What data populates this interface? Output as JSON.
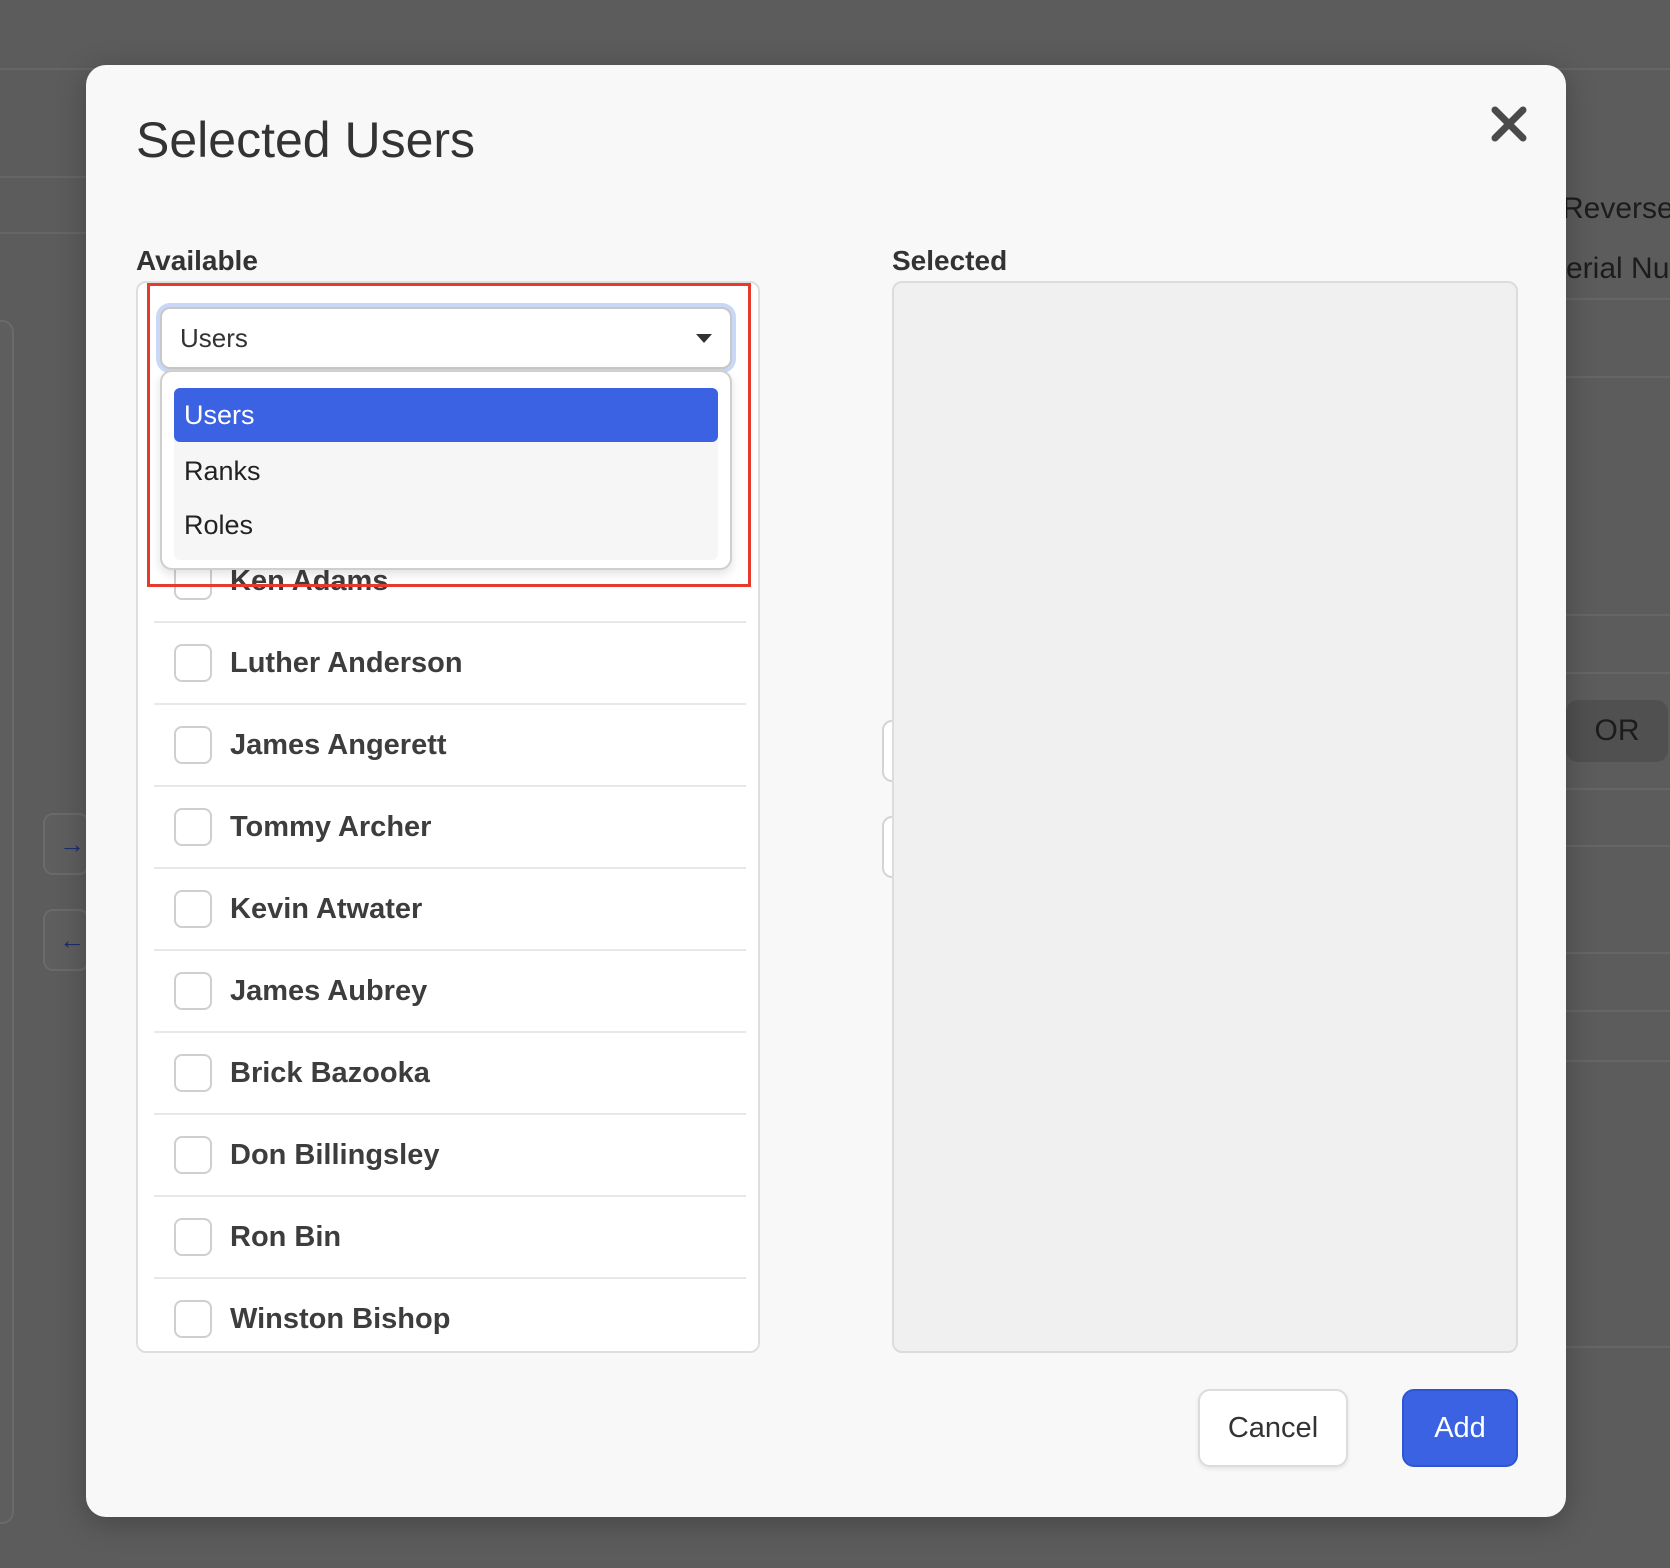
{
  "background": {
    "partial_text_1": "Reversed",
    "partial_text_2": "erial Nu",
    "pill_label": "OR"
  },
  "modal": {
    "title": "Selected Users",
    "close_icon": "close-icon",
    "available_label": "Available",
    "selected_label": "Selected",
    "dropdown": {
      "selected_value": "Users",
      "options": [
        {
          "label": "Users",
          "active": true
        },
        {
          "label": "Ranks",
          "active": false
        },
        {
          "label": "Roles",
          "active": false
        }
      ]
    },
    "users": [
      {
        "name": "Ken Adams"
      },
      {
        "name": "Luther Anderson"
      },
      {
        "name": "James Angerett"
      },
      {
        "name": "Tommy Archer"
      },
      {
        "name": "Kevin Atwater"
      },
      {
        "name": "James Aubrey"
      },
      {
        "name": "Brick Bazooka"
      },
      {
        "name": "Don Billingsley"
      },
      {
        "name": "Ron Bin"
      },
      {
        "name": "Winston Bishop"
      }
    ],
    "transfer": {
      "move_right_icon": "arrow-right-icon",
      "move_left_icon": "arrow-left-icon"
    },
    "buttons": {
      "cancel": "Cancel",
      "add": "Add"
    },
    "colors": {
      "accent": "#3a62e2",
      "highlight": "#e53a2c"
    }
  }
}
